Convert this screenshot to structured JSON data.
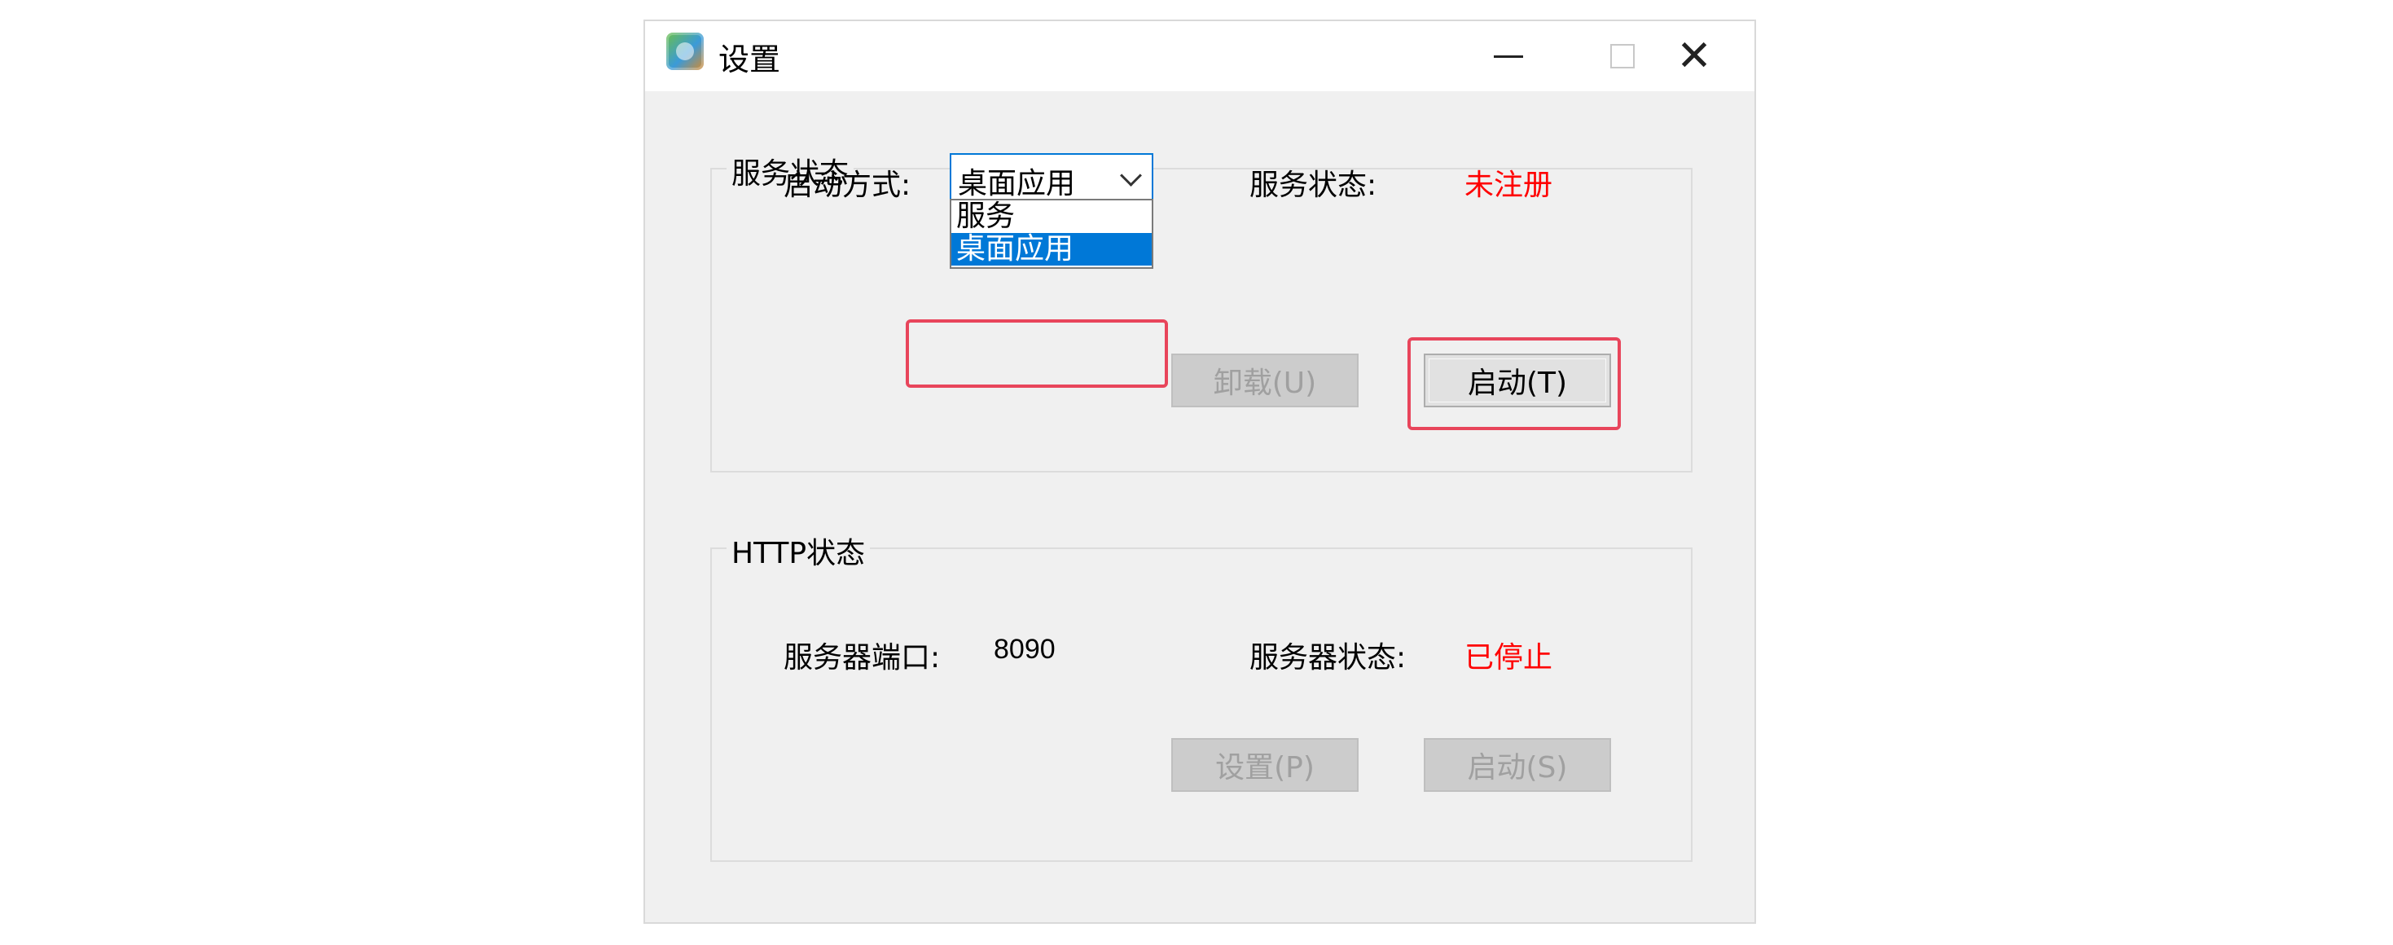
{
  "window": {
    "title": "设置",
    "controls": {
      "minimize": "minimize-icon",
      "maximize": "maximize-icon",
      "close": "close-icon"
    }
  },
  "service_group": {
    "legend": "服务状态",
    "startup_mode_label": "启动方式:",
    "startup_mode_value": "桌面应用",
    "startup_mode_options": [
      "服务",
      "桌面应用"
    ],
    "startup_mode_selected_option": "桌面应用",
    "status_label": "服务状态:",
    "status_value": "未注册",
    "uninstall_button": "卸载(U)",
    "start_button": "启动(T)"
  },
  "http_group": {
    "legend": "HTTP状态",
    "port_label": "服务器端口:",
    "port_value": "8090",
    "status_label": "服务器状态:",
    "status_value": "已停止",
    "settings_button": "设置(P)",
    "start_button": "启动(S)"
  },
  "colors": {
    "status_red": "#ff0000",
    "selection_blue": "#0078d7",
    "highlight_box": "#e8455b"
  }
}
